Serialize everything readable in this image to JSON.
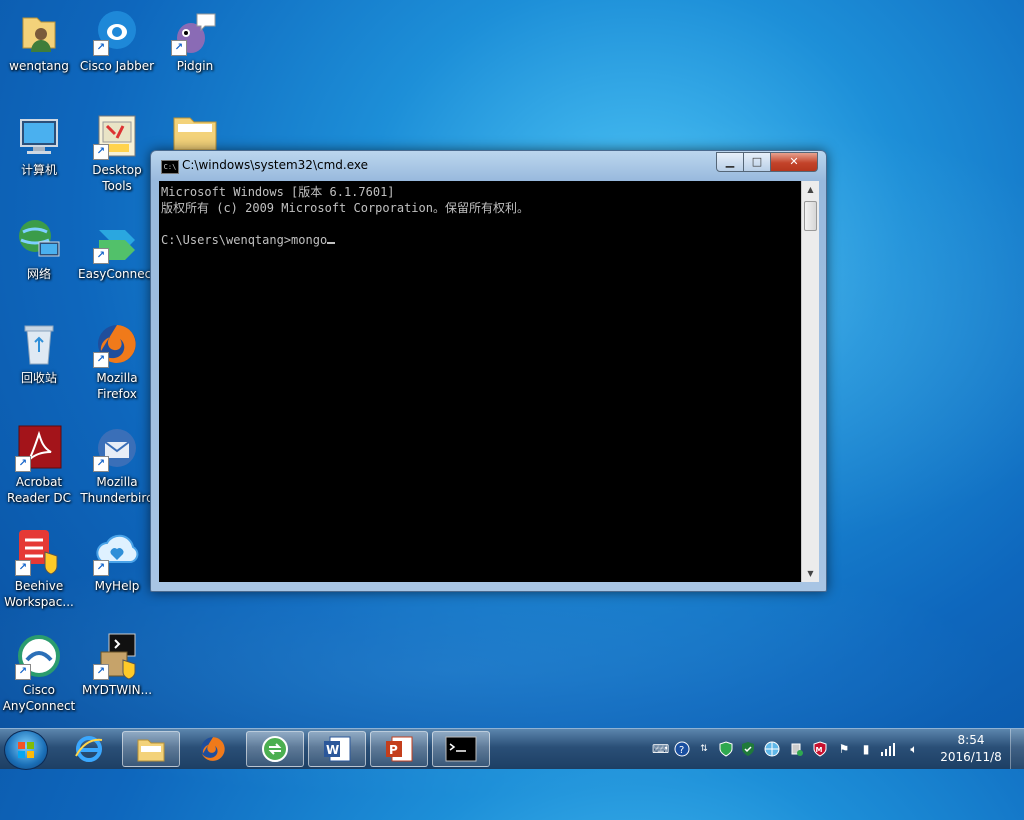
{
  "desktop": {
    "icons": [
      {
        "label": "wenqtang",
        "icon": "user-folder-icon"
      },
      {
        "label": "Cisco Jabber",
        "icon": "cisco-jabber-icon"
      },
      {
        "label": "Pidgin",
        "icon": "pidgin-icon"
      },
      {
        "label": "计算机",
        "icon": "computer-icon"
      },
      {
        "label": "Desktop Tools",
        "icon": "desktop-tools-icon"
      },
      {
        "label": "网络",
        "icon": "network-icon"
      },
      {
        "label": "EasyConnect",
        "icon": "easyconnect-icon"
      },
      {
        "label": "回收站",
        "icon": "recycle-bin-icon"
      },
      {
        "label": "Mozilla Firefox",
        "icon": "firefox-icon"
      },
      {
        "label": "Acrobat Reader DC",
        "icon": "acrobat-icon"
      },
      {
        "label": "Mozilla Thunderbird",
        "icon": "thunderbird-icon"
      },
      {
        "label": "Beehive Workspac...",
        "icon": "beehive-icon"
      },
      {
        "label": "MyHelp",
        "icon": "myhelp-icon"
      },
      {
        "label": "Cisco AnyConnect",
        "icon": "anyconnect-icon"
      },
      {
        "label": "MYDTWIN...",
        "icon": "installer-icon"
      }
    ]
  },
  "cmd_window": {
    "title": "C:\\windows\\system32\\cmd.exe",
    "title_icon_text": "C:\\",
    "buttons": {
      "minimize": "▁",
      "maximize": "□",
      "close": "✕"
    },
    "lines": [
      "Microsoft Windows [版本 6.1.7601]",
      "版权所有 (c) 2009 Microsoft Corporation。保留所有权利。",
      "",
      "C:\\Users\\wenqtang>mongo"
    ]
  },
  "taskbar": {
    "pinned": [
      {
        "name": "internet-explorer",
        "icon": "ie-icon"
      },
      {
        "name": "windows-explorer",
        "icon": "explorer-icon"
      },
      {
        "name": "firefox",
        "icon": "firefox-icon"
      },
      {
        "name": "sync-app",
        "icon": "sync-icon"
      },
      {
        "name": "word",
        "icon": "word-icon"
      },
      {
        "name": "powerpoint",
        "icon": "powerpoint-icon"
      },
      {
        "name": "cmd",
        "icon": "cmd-icon",
        "active": true
      }
    ],
    "tray_icons": [
      "keyboard-icon",
      "help-icon",
      "arrow-icon",
      "shield-icon",
      "security-icon",
      "network-globe-icon",
      "usb-icon",
      "mcafee-icon",
      "flag-icon",
      "power-icon",
      "signal-icon",
      "volume-icon"
    ],
    "clock": {
      "time": "8:54",
      "date": "2016/11/8"
    }
  },
  "colors": {
    "console_bg": "#000000",
    "console_text": "#c0c0c0",
    "close_button": "#c3432a"
  }
}
